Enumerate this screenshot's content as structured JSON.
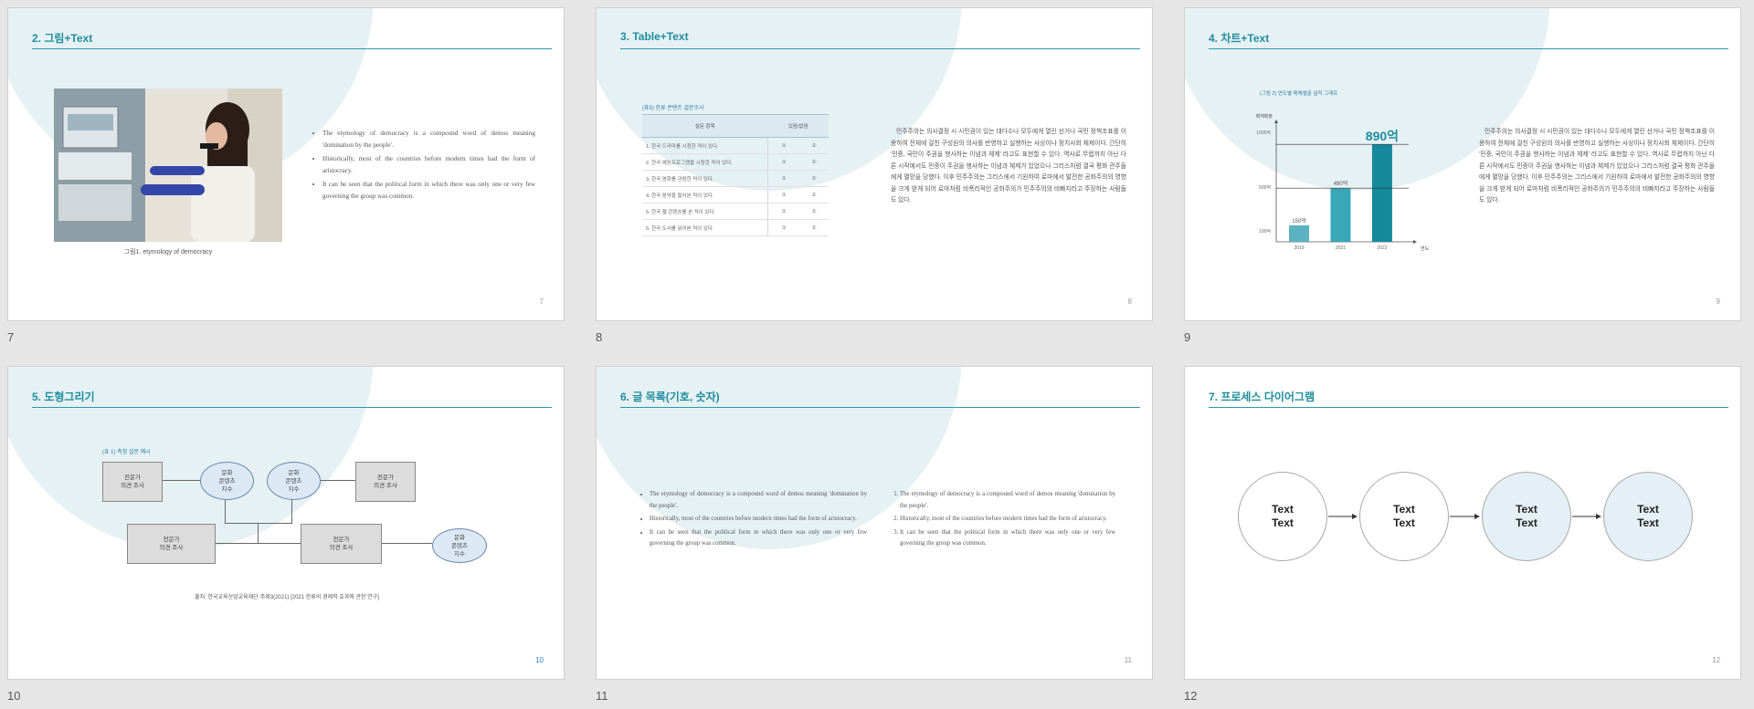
{
  "slides": [
    {
      "label": "7",
      "title": "2. 그림+Text",
      "page_number": "7",
      "caption": "그림1. etymology of democracy",
      "bullets": [
        "The etymology of democracy is a compound word of demos meaning 'domination by the people'.",
        "Historically, most of the countries before modern times had the form of aristocracy.",
        "It can be seen that the political form in which there was only one or very few governing the group was common."
      ]
    },
    {
      "label": "8",
      "title": "3. Table+Text",
      "page_number": "8",
      "table": {
        "caption": "(표5) 한류 콘텐츠 설문조사",
        "headers": [
          "설문 항목",
          "있음/없음"
        ],
        "rows": [
          [
            "1. 한국 드라마를 시청한 적이 있다.",
            "①",
            "②"
          ],
          [
            "2. 한국 예능프로그램을 시청한 적이 있다.",
            "①",
            "②"
          ],
          [
            "3. 한국 영화를 관람한 적이 있다.",
            "①",
            "②"
          ],
          [
            "4. 한국 음악을 들어본 적이 있다.",
            "①",
            "②"
          ],
          [
            "5. 한국 웹 콘텐츠를 본 적이 있다.",
            "①",
            "②"
          ],
          [
            "6. 한국 도서를 읽어본 적이 있다.",
            "①",
            "②"
          ]
        ]
      },
      "paragraph": "민주주의는 의사결정 시 시민권이 있는 대다수나 모두에게 열린 선거나 국민 정책조표를 이용하여 전체에 걸친 구성원의 의사를 반영하고 실행하는 사상이나 정치사회 체제이다. 간단히 '민중, 국민이 주권을 행사하는 이념과 체제' 라고도 표현할 수 있다. 역사로 무렵까지 아닌 다른 시작에서도 민중이 주권을 행사하는 이념과 체제가 있었으나 그리스처럼 결국 평화 관주들에게 멸망을 당했다. 이후 민주주의는 그리스에서 기원하여 로마에서 발전한 공화주의의 영향을 크게 받게 되어 로마처럼 비폭리적인 공화주의가 민주주의의 비빠지라고 주장하는 사람들도 있다."
    },
    {
      "label": "9",
      "title": "4. 차트+Text",
      "page_number": "9",
      "paragraph": "민주주의는 의사결정 시 시민권이 있는 대다수나 모두에게 열린 선거나 국민 정책조표를 이용하여 전체에 걸친 구성원의 의사를 반영하고 실행하는 사상이나 정치사회 체제이다. 간단히 '민중, 국민이 주권을 행사하는 이념과 체제' 라고도 표현할 수 있다. 역사로 무렵까지 아닌 다른 시작에서도 민중이 주권을 행사하는 이념과 체제가 있었으나 그리스처럼 결국 평화 관주들에게 멸망을 당했다. 이후 민주주의는 그리스에서 기원하여 로마에서 발전한 공화주의의 영향을 크게 받게 되어 로마처럼 비폭리적인 공화주의가 민주주의의 비빠지라고 주장하는 사람들도 있다."
    },
    {
      "label": "10",
      "title": "5. 도형그리기",
      "page_number": "10",
      "diagram_caption": "(표 1) 측정 설문 예시",
      "source": "출처: 한국교육산업교육재단·주제3(2021) [2021 한류의 경제적 효과에 관한 연구]",
      "shapes": {
        "expert_survey": "전문가\n의견 조사",
        "culture_index": "문화\n콘텐츠\n지수"
      }
    },
    {
      "label": "11",
      "title": "6. 글 목록(기호, 숫자)",
      "page_number": "11",
      "bullets": [
        "The etymology of democracy is a compound word of demos meaning 'domination by the people'.",
        "Historically, most of the countries before modern times had the form of aristocracy.",
        "It can be seen that the political form in which there was only one or very few governing the group was common."
      ],
      "numbered": [
        "The etymology of democracy is a compound word of demos meaning 'domination by the people'.",
        "Historically, most of the countries before modern times had the form of aristocracy.",
        "It can be seen that the political form in which there was only one or very few governing the group was common."
      ]
    },
    {
      "label": "12",
      "title": "7. 프로세스 다이어그램",
      "page_number": "12",
      "steps": [
        "Text\nText",
        "Text\nText",
        "Text\nText",
        "Text\nText"
      ]
    }
  ],
  "chart_data": {
    "type": "bar",
    "title": "(그림 2) 연도별 매체별출 실적 그래프",
    "ylabel": "매체매출",
    "xlabel": "연도",
    "categories": [
      "2019",
      "2021",
      "2022"
    ],
    "values": [
      150,
      490,
      890
    ],
    "value_labels": [
      "150억",
      "490억",
      "890억"
    ],
    "y_ticks": [
      "100억",
      "500억",
      "1000억"
    ],
    "ylim": [
      0,
      1000
    ],
    "colors": [
      "#5bb3c2",
      "#3aa7b8",
      "#14899b"
    ]
  }
}
